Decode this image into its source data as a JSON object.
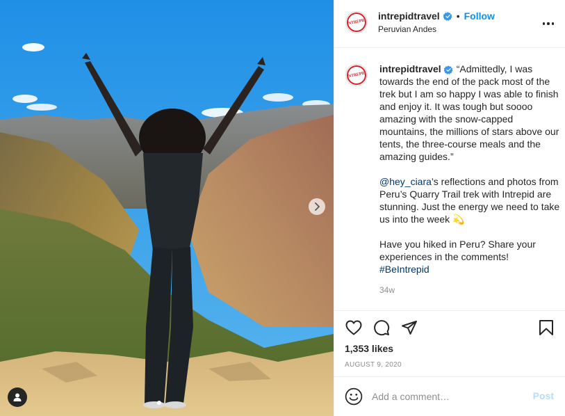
{
  "post": {
    "username": "intrepidtravel",
    "avatar_text": "INTREPID",
    "separator": "•",
    "follow_label": "Follow",
    "location": "Peruvian Andes",
    "caption": {
      "quote": "“Admittedly, I was towards the end of the pack most of the trek but I am so happy I was able to finish and enjoy it. It was tough but soooo amazing with the snow-capped mountains, the millions of stars above our tents, the three-course meals and the amazing guides.”",
      "mention": "@hey_ciara",
      "para2_rest": "’s reflections and photos from Peru’s Quarry Trail trek with Intrepid are stunning. Just the energy we need to take us into the week 💫",
      "para3": "Have you hiked in Peru? Share your experiences in the comments!",
      "hashtag": "#BeIntrepid"
    },
    "time_ago": "34w",
    "likes": "1,353 likes",
    "date": "AUGUST 9, 2020"
  },
  "comment": {
    "placeholder": "Add a comment…",
    "post_label": "Post"
  },
  "icons": {
    "verified": "verified-badge-icon",
    "more": "more-options-icon",
    "like": "heart-icon",
    "comment": "comment-icon",
    "share": "share-icon",
    "save": "bookmark-icon",
    "emoji": "emoji-icon",
    "next": "chevron-right-icon",
    "tag": "user-tag-icon"
  },
  "colors": {
    "accent": "#0095f6",
    "brand": "#d8232a",
    "post_disabled": "#b2dffc",
    "sky": "#2e9be8"
  }
}
